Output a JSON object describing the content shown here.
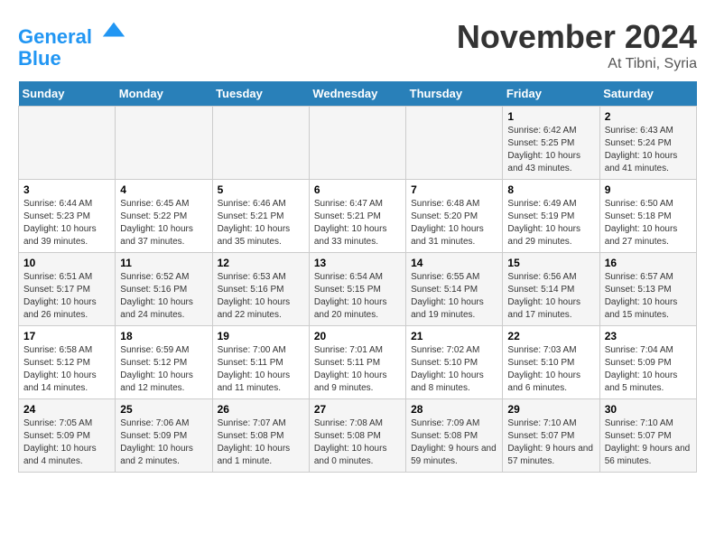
{
  "header": {
    "logo_line1": "General",
    "logo_line2": "Blue",
    "month": "November 2024",
    "location": "At Tibni, Syria"
  },
  "days_of_week": [
    "Sunday",
    "Monday",
    "Tuesday",
    "Wednesday",
    "Thursday",
    "Friday",
    "Saturday"
  ],
  "weeks": [
    [
      {
        "day": "",
        "info": ""
      },
      {
        "day": "",
        "info": ""
      },
      {
        "day": "",
        "info": ""
      },
      {
        "day": "",
        "info": ""
      },
      {
        "day": "",
        "info": ""
      },
      {
        "day": "1",
        "info": "Sunrise: 6:42 AM\nSunset: 5:25 PM\nDaylight: 10 hours and 43 minutes."
      },
      {
        "day": "2",
        "info": "Sunrise: 6:43 AM\nSunset: 5:24 PM\nDaylight: 10 hours and 41 minutes."
      }
    ],
    [
      {
        "day": "3",
        "info": "Sunrise: 6:44 AM\nSunset: 5:23 PM\nDaylight: 10 hours and 39 minutes."
      },
      {
        "day": "4",
        "info": "Sunrise: 6:45 AM\nSunset: 5:22 PM\nDaylight: 10 hours and 37 minutes."
      },
      {
        "day": "5",
        "info": "Sunrise: 6:46 AM\nSunset: 5:21 PM\nDaylight: 10 hours and 35 minutes."
      },
      {
        "day": "6",
        "info": "Sunrise: 6:47 AM\nSunset: 5:21 PM\nDaylight: 10 hours and 33 minutes."
      },
      {
        "day": "7",
        "info": "Sunrise: 6:48 AM\nSunset: 5:20 PM\nDaylight: 10 hours and 31 minutes."
      },
      {
        "day": "8",
        "info": "Sunrise: 6:49 AM\nSunset: 5:19 PM\nDaylight: 10 hours and 29 minutes."
      },
      {
        "day": "9",
        "info": "Sunrise: 6:50 AM\nSunset: 5:18 PM\nDaylight: 10 hours and 27 minutes."
      }
    ],
    [
      {
        "day": "10",
        "info": "Sunrise: 6:51 AM\nSunset: 5:17 PM\nDaylight: 10 hours and 26 minutes."
      },
      {
        "day": "11",
        "info": "Sunrise: 6:52 AM\nSunset: 5:16 PM\nDaylight: 10 hours and 24 minutes."
      },
      {
        "day": "12",
        "info": "Sunrise: 6:53 AM\nSunset: 5:16 PM\nDaylight: 10 hours and 22 minutes."
      },
      {
        "day": "13",
        "info": "Sunrise: 6:54 AM\nSunset: 5:15 PM\nDaylight: 10 hours and 20 minutes."
      },
      {
        "day": "14",
        "info": "Sunrise: 6:55 AM\nSunset: 5:14 PM\nDaylight: 10 hours and 19 minutes."
      },
      {
        "day": "15",
        "info": "Sunrise: 6:56 AM\nSunset: 5:14 PM\nDaylight: 10 hours and 17 minutes."
      },
      {
        "day": "16",
        "info": "Sunrise: 6:57 AM\nSunset: 5:13 PM\nDaylight: 10 hours and 15 minutes."
      }
    ],
    [
      {
        "day": "17",
        "info": "Sunrise: 6:58 AM\nSunset: 5:12 PM\nDaylight: 10 hours and 14 minutes."
      },
      {
        "day": "18",
        "info": "Sunrise: 6:59 AM\nSunset: 5:12 PM\nDaylight: 10 hours and 12 minutes."
      },
      {
        "day": "19",
        "info": "Sunrise: 7:00 AM\nSunset: 5:11 PM\nDaylight: 10 hours and 11 minutes."
      },
      {
        "day": "20",
        "info": "Sunrise: 7:01 AM\nSunset: 5:11 PM\nDaylight: 10 hours and 9 minutes."
      },
      {
        "day": "21",
        "info": "Sunrise: 7:02 AM\nSunset: 5:10 PM\nDaylight: 10 hours and 8 minutes."
      },
      {
        "day": "22",
        "info": "Sunrise: 7:03 AM\nSunset: 5:10 PM\nDaylight: 10 hours and 6 minutes."
      },
      {
        "day": "23",
        "info": "Sunrise: 7:04 AM\nSunset: 5:09 PM\nDaylight: 10 hours and 5 minutes."
      }
    ],
    [
      {
        "day": "24",
        "info": "Sunrise: 7:05 AM\nSunset: 5:09 PM\nDaylight: 10 hours and 4 minutes."
      },
      {
        "day": "25",
        "info": "Sunrise: 7:06 AM\nSunset: 5:09 PM\nDaylight: 10 hours and 2 minutes."
      },
      {
        "day": "26",
        "info": "Sunrise: 7:07 AM\nSunset: 5:08 PM\nDaylight: 10 hours and 1 minute."
      },
      {
        "day": "27",
        "info": "Sunrise: 7:08 AM\nSunset: 5:08 PM\nDaylight: 10 hours and 0 minutes."
      },
      {
        "day": "28",
        "info": "Sunrise: 7:09 AM\nSunset: 5:08 PM\nDaylight: 9 hours and 59 minutes."
      },
      {
        "day": "29",
        "info": "Sunrise: 7:10 AM\nSunset: 5:07 PM\nDaylight: 9 hours and 57 minutes."
      },
      {
        "day": "30",
        "info": "Sunrise: 7:10 AM\nSunset: 5:07 PM\nDaylight: 9 hours and 56 minutes."
      }
    ]
  ]
}
